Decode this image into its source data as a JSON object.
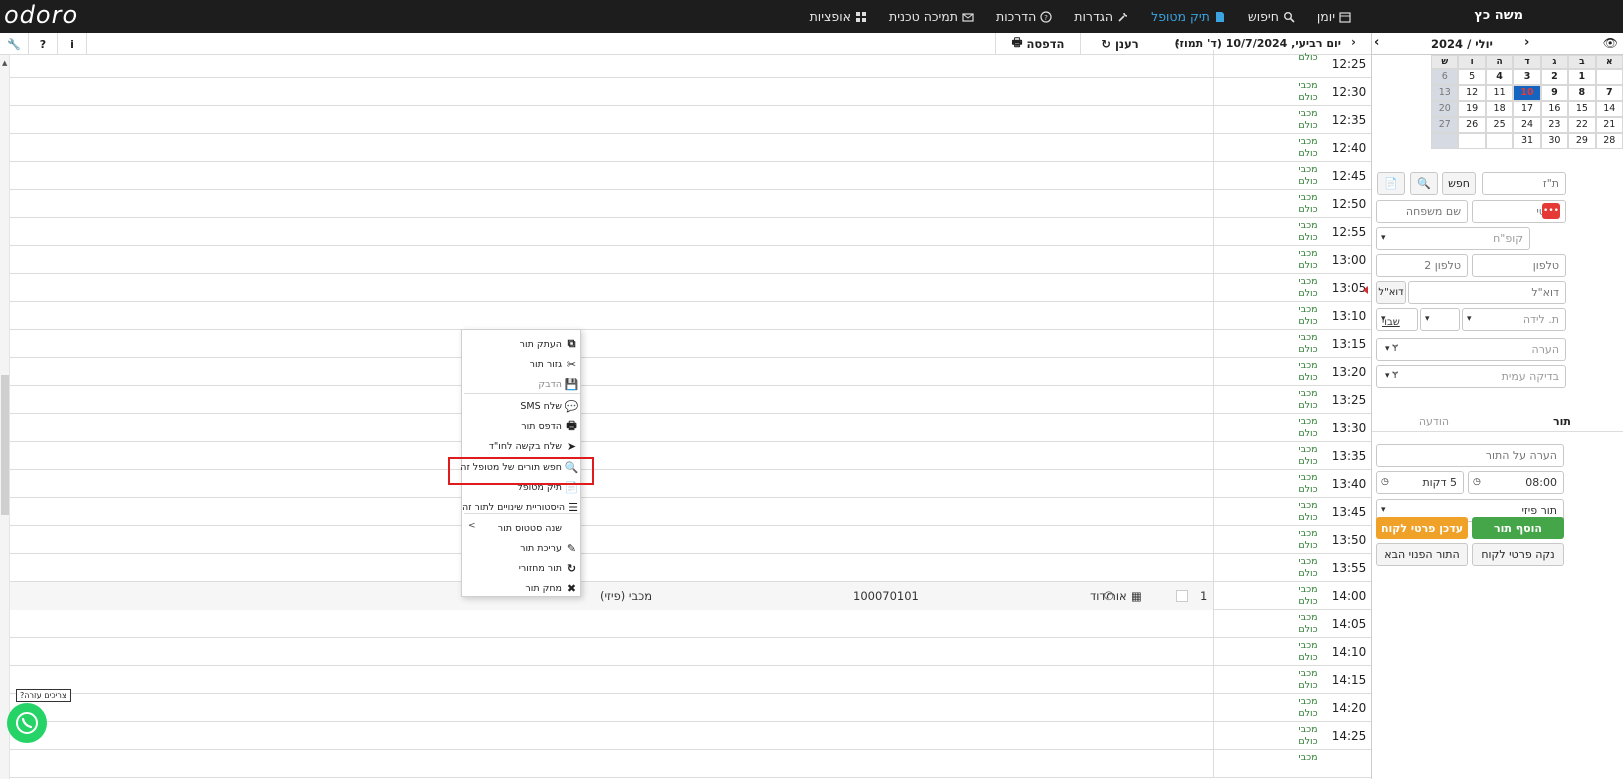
{
  "app": {
    "logo": "odoro",
    "user_name": "משה כץ"
  },
  "nav": [
    {
      "label": "יומן",
      "icon": "calendar-icon"
    },
    {
      "label": "חיפוש",
      "icon": "search-icon"
    },
    {
      "label": "תיק מטופל",
      "icon": "file-icon",
      "active": true
    },
    {
      "label": "הגדרות",
      "icon": "wrench-icon"
    },
    {
      "label": "הדרכות",
      "icon": "question-icon"
    },
    {
      "label": "תמיכה טכנית",
      "icon": "envelope-icon"
    },
    {
      "label": "אופציות",
      "icon": "grid-icon"
    }
  ],
  "left_tools": [
    "i",
    "?"
  ],
  "schedule": {
    "print_label": "הדפסה",
    "refresh_label": "רענן",
    "date_label": "יום רביעי, 10/7/2024 (ד' תמוז)",
    "rows": [
      {
        "time": "12:25",
        "who": "כולם",
        "who2": ""
      },
      {
        "time": "12:30",
        "who": "מכבי",
        "who2": "כולם"
      },
      {
        "time": "12:35",
        "who": "מכבי",
        "who2": "כולם"
      },
      {
        "time": "12:40",
        "who": "מכבי",
        "who2": "כולם"
      },
      {
        "time": "12:45",
        "who": "מכבי",
        "who2": "כולם"
      },
      {
        "time": "12:50",
        "who": "מכבי",
        "who2": "כולם"
      },
      {
        "time": "12:55",
        "who": "מכבי",
        "who2": "כולם"
      },
      {
        "time": "13:00",
        "who": "מכבי",
        "who2": "כולם"
      },
      {
        "time": "13:05",
        "who": "מכבי",
        "who2": "כולם"
      },
      {
        "time": "13:10",
        "who": "מכבי",
        "who2": "כולם"
      },
      {
        "time": "13:15",
        "who": "מכבי",
        "who2": "כולם"
      },
      {
        "time": "13:20",
        "who": "מכבי",
        "who2": "כולם"
      },
      {
        "time": "13:25",
        "who": "מכבי",
        "who2": "כולם"
      },
      {
        "time": "13:30",
        "who": "מכבי",
        "who2": "כולם"
      },
      {
        "time": "13:35",
        "who": "מכבי",
        "who2": "כולם"
      },
      {
        "time": "13:40",
        "who": "מכבי",
        "who2": "כולם"
      },
      {
        "time": "13:45",
        "who": "מכבי",
        "who2": "כולם"
      },
      {
        "time": "13:50",
        "who": "מכבי",
        "who2": "כולם"
      },
      {
        "time": "13:55",
        "who": "מכבי",
        "who2": "כולם"
      },
      {
        "time": "14:00",
        "who": "מכבי",
        "who2": "כולם"
      },
      {
        "time": "14:05",
        "who": "מכבי",
        "who2": "כולם"
      },
      {
        "time": "14:10",
        "who": "מכבי",
        "who2": "כולם"
      },
      {
        "time": "14:15",
        "who": "מכבי",
        "who2": "כולם"
      },
      {
        "time": "14:20",
        "who": "מכבי",
        "who2": "כולם"
      },
      {
        "time": "14:25",
        "who": "מכבי",
        "who2": "כולם"
      },
      {
        "time": "",
        "who": "מכבי",
        "who2": ""
      }
    ],
    "booked": {
      "count": "1",
      "patient_name": "אור דוד",
      "id_number": "100070101",
      "fund": "מכבי (פיזי)"
    }
  },
  "context_menu": {
    "items": [
      {
        "label": "העתק תור",
        "icon": "copy-icon",
        "disabled": false
      },
      {
        "label": "גזור תור",
        "icon": "scissors-icon",
        "disabled": false
      },
      {
        "label": "הדבק",
        "icon": "save-icon",
        "disabled": true
      },
      {
        "label": "שלח SMS",
        "icon": "chat-icon",
        "disabled": false
      },
      {
        "label": "הדפס תור",
        "icon": "print-icon",
        "disabled": false
      },
      {
        "label": "שלח בקשה לחו\"ד",
        "icon": "send-icon",
        "disabled": false
      },
      {
        "label": "חפש תורים של מטופל זה",
        "icon": "search-icon",
        "disabled": false
      },
      {
        "label": "תיק מטופל",
        "icon": "file-icon",
        "disabled": false
      },
      {
        "label": "היסטוריית שינויים לתור זה",
        "icon": "list-icon",
        "disabled": false
      },
      {
        "label": "שנה סטטוס תור",
        "icon": "",
        "disabled": false,
        "submenu": ">"
      },
      {
        "label": "עריכת תור",
        "icon": "pencil-icon",
        "disabled": false
      },
      {
        "label": "תור מחזורי",
        "icon": "repeat-icon",
        "disabled": false
      },
      {
        "label": "מחק תור",
        "icon": "x-icon",
        "disabled": false
      }
    ]
  },
  "calendar": {
    "title": "יולי / 2024",
    "dow": [
      "א",
      "ב",
      "ג",
      "ד",
      "ה",
      "ו",
      "ש"
    ],
    "weeks": [
      [
        "7",
        "8",
        "9",
        "10",
        "11",
        "12",
        "13"
      ]
    ],
    "week_rows": [
      [
        "",
        "1",
        "2",
        "3",
        "4",
        "5",
        "6"
      ],
      [
        "7",
        "8",
        "9",
        "10",
        "11",
        "12",
        "13"
      ],
      [
        "14",
        "15",
        "16",
        "17",
        "18",
        "19",
        "20"
      ],
      [
        "21",
        "22",
        "23",
        "24",
        "25",
        "26",
        "27"
      ],
      [
        "28",
        "29",
        "30",
        "31",
        "",
        "",
        ""
      ]
    ],
    "today": "10"
  },
  "patient_form": {
    "id_placeholder": "ת\"ז",
    "search_label": "חפש",
    "first_name_placeholder": "פרטי",
    "last_name_placeholder": "שם משפחה",
    "fund_placeholder": "קופ\"ח",
    "phone_placeholder": "טלפון",
    "phone2_placeholder": "טלפון 2",
    "email_placeholder": "דוא\"ל",
    "email_button": "דוא\"ל",
    "birth_placeholder": "ת. לידה",
    "shabbat_label": "שבוי",
    "note_placeholder": "הערה",
    "exam_placeholder": "בדיקה עמית"
  },
  "appointment_form": {
    "tab_appointment": "תור",
    "tab_message": "הודעה",
    "note_placeholder": "הערה על התור",
    "time_value": "08:00",
    "duration_value": "5 דקות",
    "type_value": "תור פיזי",
    "add_button": "הוסף תור",
    "update_button": "עדכן פרטי לקוח",
    "clear_button": "נקה פרטי לקוח",
    "next_button": "התור הפנוי הבא"
  },
  "whatsapp": {
    "bubble_text": "צריכים עזרה?"
  },
  "colors": {
    "accent": "#3ba3e0",
    "green": "#45a649",
    "orange": "#f0a127",
    "highlight": "#e01b1b",
    "today": "#1565c0"
  }
}
